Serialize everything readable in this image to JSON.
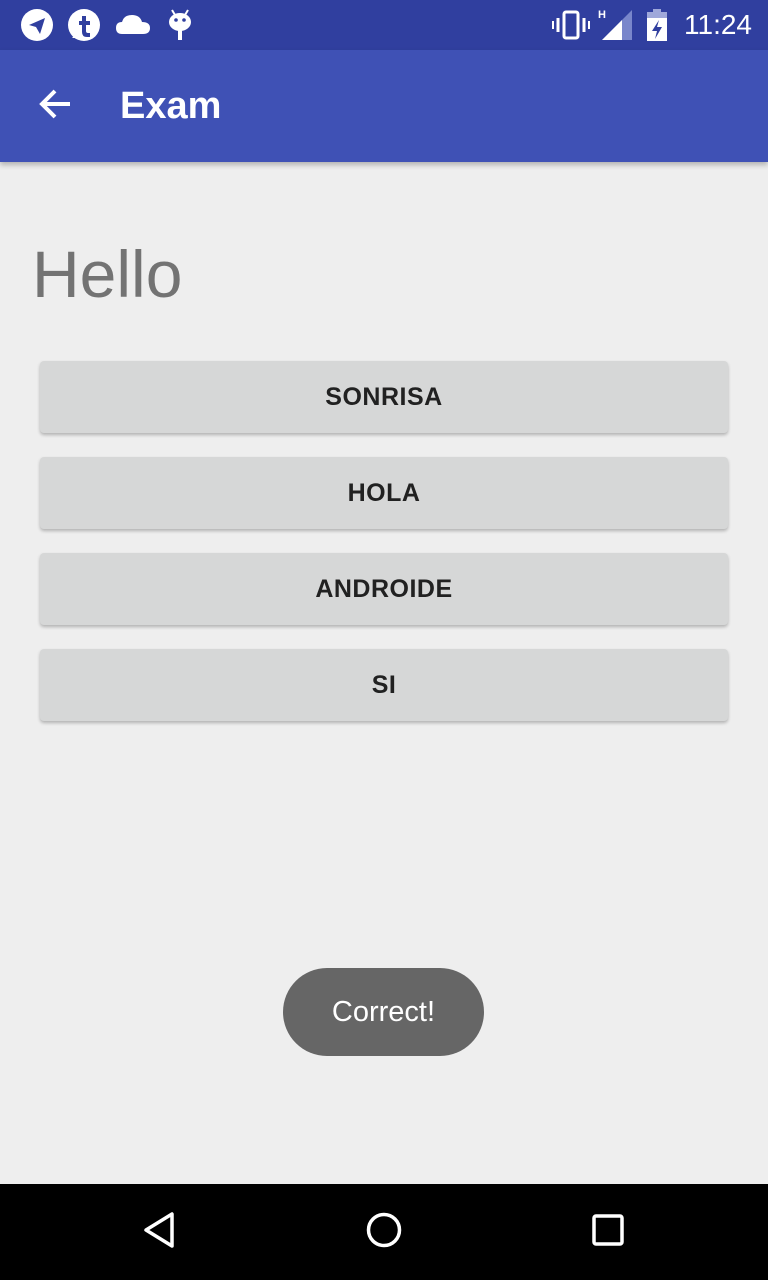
{
  "status_bar": {
    "time": "11:24",
    "notification_icons": [
      "telegram-icon",
      "tumblr-icon",
      "cloud-icon",
      "android-icon"
    ],
    "system_icons": [
      "vibrate-icon",
      "signal-h-icon",
      "battery-charging-icon"
    ],
    "signal_type": "H"
  },
  "app_bar": {
    "title": "Exam",
    "back_icon": "arrow-back-icon",
    "color": "#3f51b5"
  },
  "main": {
    "prompt_word": "Hello",
    "answers": [
      {
        "label": "SONRISA"
      },
      {
        "label": "HOLA"
      },
      {
        "label": "ANDROIDE"
      },
      {
        "label": "SI"
      }
    ]
  },
  "toast": {
    "message": "Correct!"
  },
  "nav_bar": {
    "buttons": [
      "back-triangle-icon",
      "home-circle-icon",
      "recents-square-icon"
    ]
  }
}
